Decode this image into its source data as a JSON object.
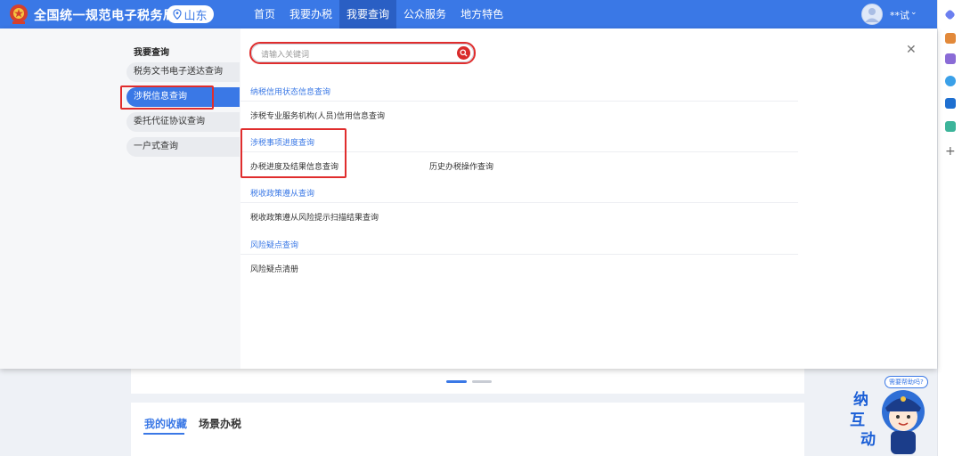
{
  "header": {
    "site_title": "全国统一规范电子税务局",
    "region": "山东",
    "nav": [
      "首页",
      "我要办税",
      "我要查询",
      "公众服务",
      "地方特色"
    ],
    "active_nav_index": 2,
    "user_name": "**试",
    "accent_color": "#3a78e6"
  },
  "menu": {
    "left_title": "我要查询",
    "left_items": [
      "税务文书电子送达查询",
      "涉税信息查询",
      "委托代征协议查询",
      "一户式查询"
    ],
    "active_left_index": 1,
    "search_placeholder": "请输入关键词",
    "groups": [
      {
        "title": "纳税信用状态信息查询",
        "links": [
          "涉税专业服务机构(人员)信用信息查询"
        ]
      },
      {
        "title": "涉税事项进度查询",
        "links": [
          "办税进度及结果信息查询",
          "历史办税操作查询"
        ]
      },
      {
        "title": "税收政策遵从查询",
        "links": [
          "税收政策遵从风险提示扫描结果查询"
        ]
      },
      {
        "title": "风险疑点查询",
        "links": [
          "风险疑点清册"
        ]
      }
    ],
    "highlight_color": "#e02d2d"
  },
  "page": {
    "tabs": [
      "我的收藏",
      "场景办税"
    ],
    "active_tab_index": 0
  },
  "mascot": {
    "bubble_text": "需要帮助吗?",
    "chars": [
      "纳",
      "互",
      "动"
    ]
  },
  "icons": {
    "logo": "tax-emblem-icon",
    "region": "location-pin-icon",
    "search": "search-icon",
    "close": "close-icon",
    "user": "user-avatar-icon",
    "caret": "chevron-down-icon"
  }
}
